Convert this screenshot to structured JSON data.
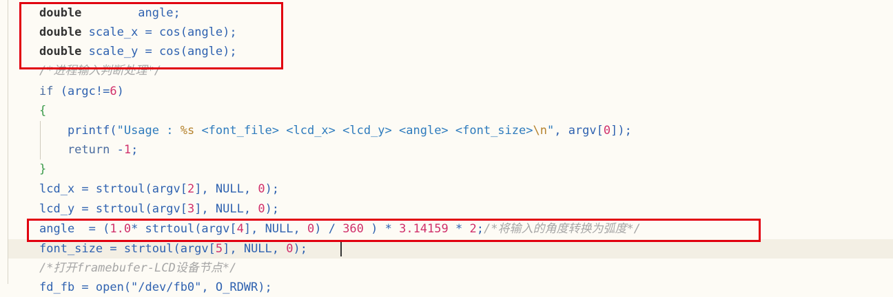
{
  "editor": {
    "lines": [
      [
        {
          "t": "double",
          "c": "type"
        },
        {
          "t": "        angle;",
          "c": "var"
        }
      ],
      [
        {
          "t": "double",
          "c": "type"
        },
        {
          "t": " scale_x = ",
          "c": "var"
        },
        {
          "t": "cos",
          "c": "fn"
        },
        {
          "t": "(angle);",
          "c": "var"
        }
      ],
      [
        {
          "t": "double",
          "c": "type"
        },
        {
          "t": " scale_y = ",
          "c": "var"
        },
        {
          "t": "cos",
          "c": "fn"
        },
        {
          "t": "(angle);",
          "c": "var"
        }
      ],
      [
        {
          "t": "/*进程输入判断处理*/",
          "c": "cmt"
        }
      ],
      [
        {
          "t": "if",
          "c": "kw"
        },
        {
          "t": " (argc!=",
          "c": "var"
        },
        {
          "t": "6",
          "c": "num"
        },
        {
          "t": ")",
          "c": "var"
        }
      ],
      [
        {
          "t": "{",
          "c": "brace"
        }
      ],
      [
        {
          "t": "    printf(",
          "c": "var"
        },
        {
          "t": "\"Usage : ",
          "c": "str"
        },
        {
          "t": "%s",
          "c": "esc"
        },
        {
          "t": " <font_file> <lcd_x> <lcd_y> <angle> <font_size>",
          "c": "str"
        },
        {
          "t": "\\n",
          "c": "esc"
        },
        {
          "t": "\"",
          "c": "str"
        },
        {
          "t": ", argv[",
          "c": "var"
        },
        {
          "t": "0",
          "c": "num"
        },
        {
          "t": "]);",
          "c": "var"
        }
      ],
      [
        {
          "t": "    return",
          "c": "kw"
        },
        {
          "t": " -",
          "c": "var"
        },
        {
          "t": "1",
          "c": "num"
        },
        {
          "t": ";",
          "c": "var"
        }
      ],
      [
        {
          "t": "}",
          "c": "brace"
        }
      ],
      [
        {
          "t": "lcd_x = strtoul(argv[",
          "c": "var"
        },
        {
          "t": "2",
          "c": "num"
        },
        {
          "t": "], NULL, ",
          "c": "var"
        },
        {
          "t": "0",
          "c": "num"
        },
        {
          "t": ");",
          "c": "var"
        }
      ],
      [
        {
          "t": "lcd_y = strtoul(argv[",
          "c": "var"
        },
        {
          "t": "3",
          "c": "num"
        },
        {
          "t": "], NULL, ",
          "c": "var"
        },
        {
          "t": "0",
          "c": "num"
        },
        {
          "t": ");",
          "c": "var"
        }
      ],
      [
        {
          "t": "angle  = (",
          "c": "var"
        },
        {
          "t": "1.0",
          "c": "num"
        },
        {
          "t": "* strtoul(argv[",
          "c": "var"
        },
        {
          "t": "4",
          "c": "num"
        },
        {
          "t": "], NULL, ",
          "c": "var"
        },
        {
          "t": "0",
          "c": "num"
        },
        {
          "t": ") / ",
          "c": "var"
        },
        {
          "t": "360",
          "c": "num"
        },
        {
          "t": " ) * ",
          "c": "var"
        },
        {
          "t": "3.14159",
          "c": "num"
        },
        {
          "t": " * ",
          "c": "var"
        },
        {
          "t": "2",
          "c": "num"
        },
        {
          "t": ";",
          "c": "var"
        },
        {
          "t": "/*将输入的角度转换为弧度*/",
          "c": "cmt"
        }
      ],
      [
        {
          "t": "font_size = strtoul(argv[",
          "c": "var"
        },
        {
          "t": "5",
          "c": "num"
        },
        {
          "t": "], NULL, ",
          "c": "var"
        },
        {
          "t": "0",
          "c": "num"
        },
        {
          "t": ");",
          "c": "var"
        }
      ],
      [
        {
          "t": "/*打开framebufer-LCD设备节点*/",
          "c": "cmt"
        }
      ],
      [
        {
          "t": "fd_fb = open(\"/dev/fb0\", O_RDWR);",
          "c": "var"
        }
      ]
    ]
  }
}
